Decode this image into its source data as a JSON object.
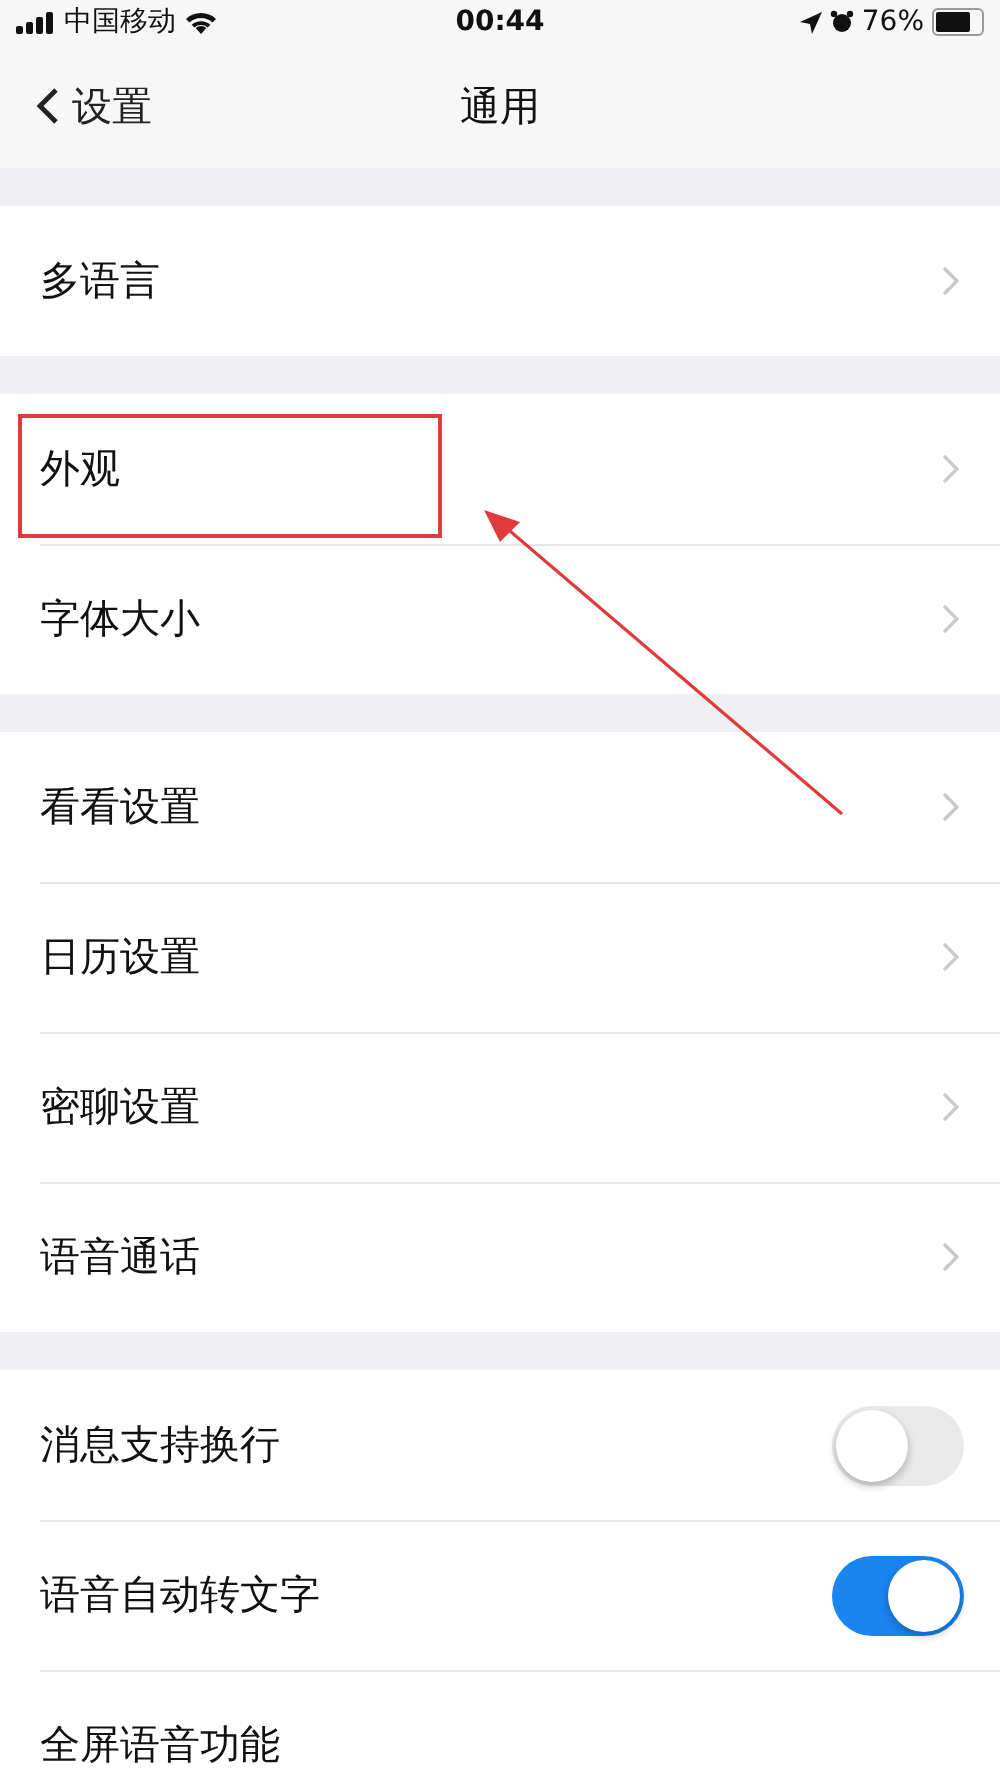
{
  "status_bar": {
    "carrier": "中国移动",
    "time": "00:44",
    "battery": "76%"
  },
  "nav": {
    "back": "设置",
    "title": "通用"
  },
  "groups": [
    [
      {
        "kind": "link",
        "label": "多语言"
      }
    ],
    [
      {
        "kind": "link",
        "label": "外观",
        "highlighted": true
      },
      {
        "kind": "link",
        "label": "字体大小"
      }
    ],
    [
      {
        "kind": "link",
        "label": "看看设置"
      },
      {
        "kind": "link",
        "label": "日历设置"
      },
      {
        "kind": "link",
        "label": "密聊设置"
      },
      {
        "kind": "link",
        "label": "语音通话"
      }
    ],
    [
      {
        "kind": "switch",
        "label": "消息支持换行",
        "on": false
      },
      {
        "kind": "switch",
        "label": "语音自动转文字",
        "on": true
      },
      {
        "kind": "plain",
        "label": "全屏语音功能"
      }
    ]
  ]
}
